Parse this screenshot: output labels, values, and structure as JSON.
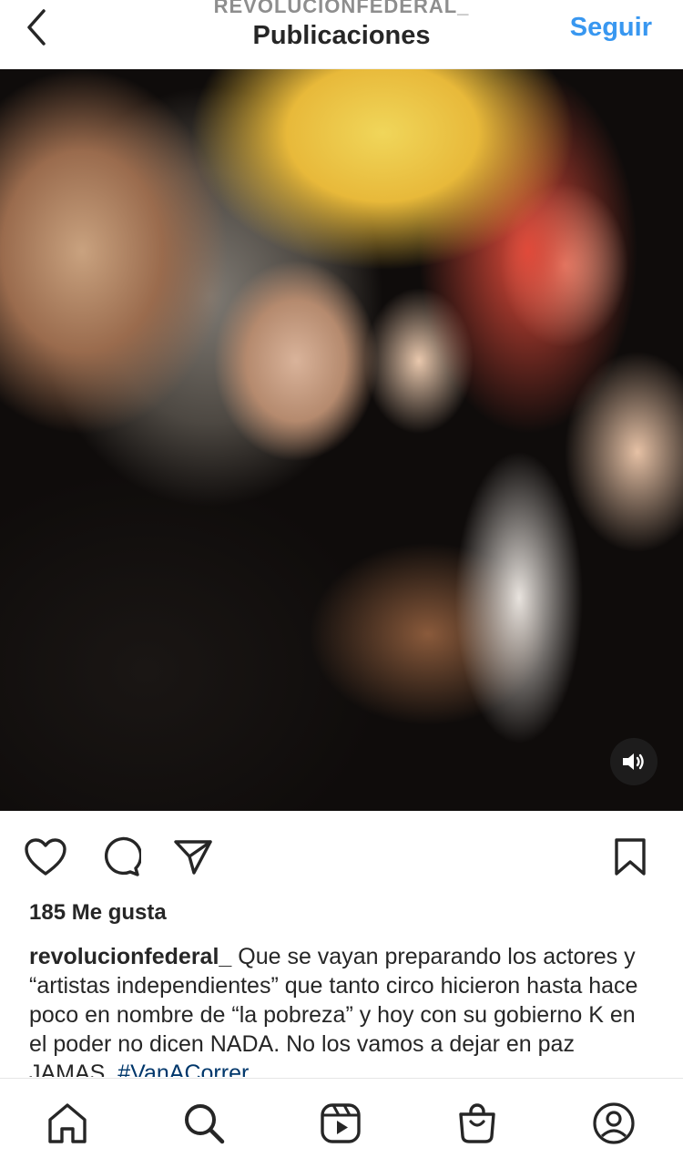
{
  "header": {
    "username": "REVOLUCIONFEDERAL_",
    "title": "Publicaciones",
    "follow_label": "Seguir"
  },
  "media": {
    "type": "video",
    "sound_icon": "speaker-icon"
  },
  "actions": {
    "icons": [
      "heart-icon",
      "comment-icon",
      "share-icon",
      "bookmark-icon"
    ]
  },
  "post": {
    "likes": "185 Me gusta",
    "caption_user": "revolucionfederal_",
    "caption_text": " Que se vayan preparando los actores y “artistas independientes” que tanto circo hicieron hasta hace poco en nombre de “la pobreza” y hoy con su gobierno K en el poder no dicen NADA. No los vamos a dejar en paz JAMAS. ",
    "hashtag": "#VanACorrer"
  },
  "bottom_nav": {
    "icons": [
      "home-icon",
      "search-icon",
      "reels-icon",
      "shop-icon",
      "profile-icon"
    ]
  }
}
